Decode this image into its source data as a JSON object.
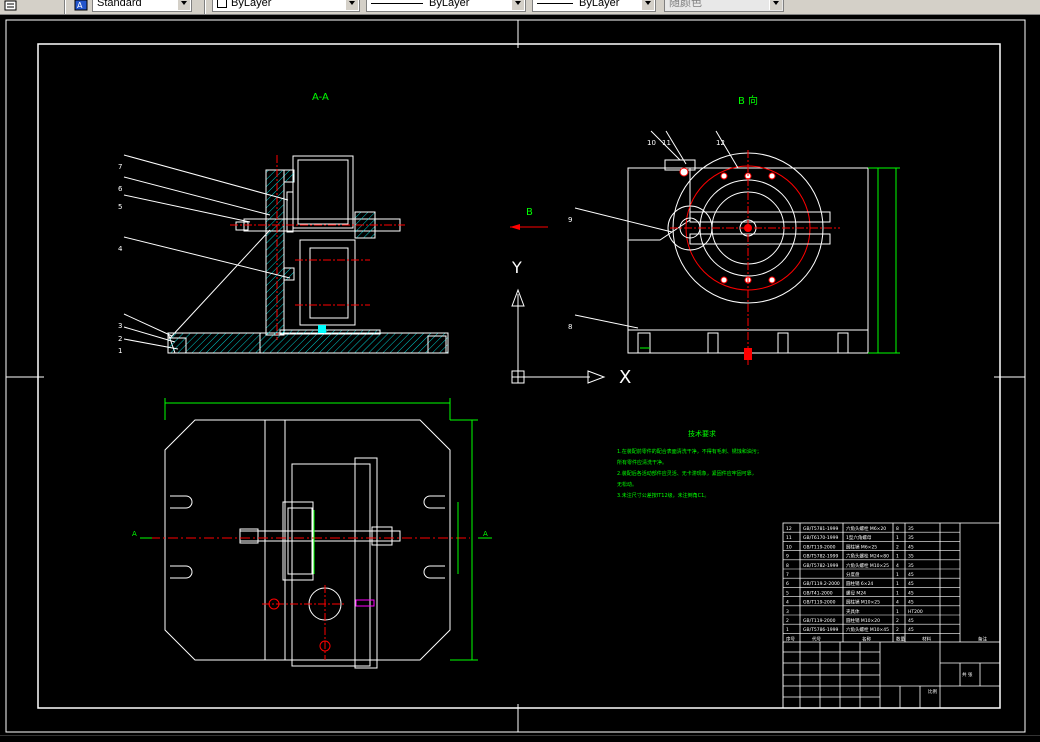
{
  "toolbar": {
    "text_style": "Standard",
    "layer": "ByLayer",
    "linetype": "ByLayer",
    "lineweight": "ByLayer",
    "color": "随颜色"
  },
  "drawing": {
    "view_aa_label": "A-A",
    "view_b_label": "B 向",
    "direction_b_label": "B",
    "axis_y": "Y",
    "axis_x": "X",
    "section_a_left": "A",
    "section_a_right": "A",
    "callouts_left": [
      "7",
      "6",
      "5",
      "4",
      "3",
      "2",
      "1"
    ],
    "callouts_right": [
      "10",
      "11",
      "12",
      "9",
      "8"
    ],
    "notes_title": "技术要求",
    "notes": [
      "1.在装配前零件的配合表面清洗干净，不得有毛刺、锈蚀和油污；",
      "所有零件应清洗干净。",
      "2.装配后各活动部件应灵活、无卡滞现象，紧固件应牢固可靠，",
      "无松动。",
      "3.未注尺寸公差按IT12级，未注倒角C1。"
    ],
    "bom": [
      {
        "no": "12",
        "code": "GB/T5781-1999",
        "name": "六角头螺栓 M6×20",
        "qty": "8",
        "mat": "35"
      },
      {
        "no": "11",
        "code": "GB/T6170-1999",
        "name": "1型六角螺母",
        "qty": "1",
        "mat": "35"
      },
      {
        "no": "10",
        "code": "GB/T119-2000",
        "name": "圆柱销 M6×25",
        "qty": "2",
        "mat": "45"
      },
      {
        "no": "9",
        "code": "GB/T5782-1999",
        "name": "六角头螺栓 M24×80",
        "qty": "1",
        "mat": "35"
      },
      {
        "no": "8",
        "code": "GB/T5782-1999",
        "name": "六角头螺栓 M10×25",
        "qty": "4",
        "mat": "35"
      },
      {
        "no": "7",
        "code": "",
        "name": "分度盘",
        "qty": "1",
        "mat": "45"
      },
      {
        "no": "6",
        "code": "GB/T119.2-2000",
        "name": "圆柱销 6×24",
        "qty": "1",
        "mat": "45"
      },
      {
        "no": "5",
        "code": "GB/T41-2000",
        "name": "螺母 M24",
        "qty": "1",
        "mat": "45"
      },
      {
        "no": "4",
        "code": "GB/T119-2000",
        "name": "圆柱销 M10×25",
        "qty": "4",
        "mat": "45"
      },
      {
        "no": "3",
        "code": "",
        "name": "夹具体",
        "qty": "1",
        "mat": "HT200"
      },
      {
        "no": "2",
        "code": "GB/T119-2000",
        "name": "圆柱销 M10×20",
        "qty": "2",
        "mat": "45"
      },
      {
        "no": "1",
        "code": "GB/T5786-1999",
        "name": "六角头螺栓 M10×45",
        "qty": "2",
        "mat": "45"
      }
    ],
    "bom_header": [
      "序号",
      "代号",
      "名称",
      "数量",
      "材料",
      "备注"
    ],
    "title_scale": "比例",
    "title_sheet": "共 张"
  },
  "colors": {
    "background": "#000000",
    "outline": "#ffffff",
    "centerline": "#ff0000",
    "dimension": "#00ff00",
    "hatch": "#00ffff",
    "text": "#ffffff"
  }
}
